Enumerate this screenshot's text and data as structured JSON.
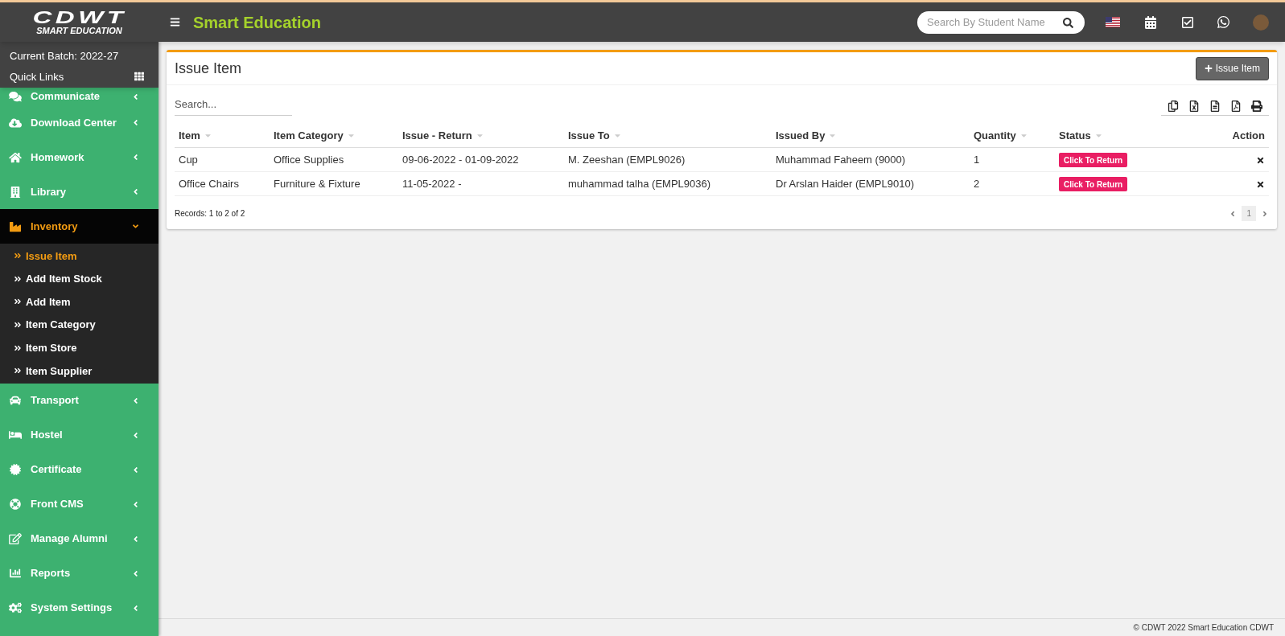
{
  "logo": {
    "title": "CDWT",
    "subtitle": "SMART EDUCATION"
  },
  "header": {
    "app_title": "Smart Education",
    "search": {
      "placeholder": "Search By Student Name"
    }
  },
  "sidebar": {
    "batch": "Current Batch: 2022-27",
    "quick_links": "Quick Links",
    "items": [
      {
        "label": "Communicate",
        "expanded": false
      },
      {
        "label": "Download Center",
        "expanded": false
      },
      {
        "label": "Homework",
        "expanded": false
      },
      {
        "label": "Library",
        "expanded": false
      },
      {
        "label": "Inventory",
        "expanded": true,
        "children": [
          {
            "label": "Issue Item",
            "selected": true
          },
          {
            "label": "Add Item Stock",
            "selected": false
          },
          {
            "label": "Add Item",
            "selected": false
          },
          {
            "label": "Item Category",
            "selected": false
          },
          {
            "label": "Item Store",
            "selected": false
          },
          {
            "label": "Item Supplier",
            "selected": false
          }
        ]
      },
      {
        "label": "Transport",
        "expanded": false
      },
      {
        "label": "Hostel",
        "expanded": false
      },
      {
        "label": "Certificate",
        "expanded": false
      },
      {
        "label": "Front CMS",
        "expanded": false
      },
      {
        "label": "Manage Alumni",
        "expanded": false
      },
      {
        "label": "Reports",
        "expanded": false
      },
      {
        "label": "System Settings",
        "expanded": false
      }
    ]
  },
  "panel": {
    "title": "Issue Item",
    "add_button": "Issue Item",
    "search": {
      "placeholder": "Search..."
    },
    "table": {
      "columns": [
        {
          "label": "Item",
          "sortable": true
        },
        {
          "label": "Item Category",
          "sortable": true
        },
        {
          "label": "Issue - Return",
          "sortable": true
        },
        {
          "label": "Issue To",
          "sortable": true
        },
        {
          "label": "Issued By",
          "sortable": true
        },
        {
          "label": "Quantity",
          "sortable": true
        },
        {
          "label": "Status",
          "sortable": true
        },
        {
          "label": "Action",
          "sortable": false
        }
      ],
      "rows": [
        {
          "item": "Cup",
          "category": "Office Supplies",
          "issue_return": "09-06-2022 - 01-09-2022",
          "issue_to": "M. Zeeshan (EMPL9026)",
          "issued_by": "Muhammad Faheem (9000)",
          "quantity": "1",
          "status": "Click To Return"
        },
        {
          "item": "Office Chairs",
          "category": "Furniture & Fixture",
          "issue_return": "11-05-2022 -",
          "issue_to": "muhammad talha (EMPL9036)",
          "issued_by": "Dr Arslan Haider (EMPL9010)",
          "quantity": "2",
          "status": "Click To Return"
        }
      ]
    },
    "records": "Records: 1 to 2 of 2",
    "pages": [
      {
        "label": "1",
        "selected": true
      }
    ]
  },
  "footer": "© CDWT 2022 Smart Education CDWT"
}
